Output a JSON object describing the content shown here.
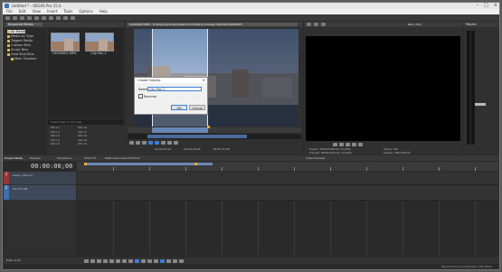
{
  "window": {
    "title": "Untitled * - VEGAS Pro 15.0"
  },
  "menu": [
    "File",
    "Edit",
    "View",
    "Insert",
    "Tools",
    "Options",
    "Help"
  ],
  "explorer": {
    "dropdown": "Imported Media",
    "tree": [
      {
        "label": "All Media",
        "selected": true
      },
      {
        "label": "Media by Type",
        "selected": false
      },
      {
        "label": "Tagged Media",
        "selected": false
      },
      {
        "label": "Custom Bins",
        "selected": false
      },
      {
        "label": "Smart Bins",
        "selected": false
      },
      {
        "label": "Hold Shot Bins",
        "selected": false
      },
      {
        "label": "Main Timeline",
        "selected": false
      }
    ],
    "media": [
      {
        "label": "C0000001.MP4"
      },
      {
        "label": "City Pan 1"
      }
    ],
    "tag_placeholder": "Select tags or add tags",
    "shortcuts": [
      {
        "key": "Ctrl+1",
        "value": "Ctrl+6"
      },
      {
        "key": "Ctrl+2",
        "value": "Ctrl+7"
      },
      {
        "key": "Ctrl+3",
        "value": "Ctrl+8"
      },
      {
        "key": "Ctrl+4",
        "value": "Ctrl+9"
      },
      {
        "key": "Ctrl+5",
        "value": "Ctrl+0"
      }
    ]
  },
  "trimmer": {
    "tab": "C0000001.MP4 - D:\\Ongoing Projects\\Random Building Footage 1\\DCIM\\100MSDCF\\",
    "status": [
      "00:00:04.24",
      "00:00:09.08",
      "00:00:05.08"
    ]
  },
  "dialog": {
    "title": "Create Subclip",
    "name_label": "Name:",
    "name_value": "City Pan 2",
    "reverse_label": "Reverse",
    "ok": "OK",
    "cancel": "Cancel"
  },
  "preview": {
    "quality": "Best (Full)",
    "info": {
      "project": "Project:  3840x2160x32, 23.976p",
      "preview": "Preview:  3840x2160x32, 23.976p",
      "frame": "Frame:   140",
      "display": "Display:  285x160x32"
    }
  },
  "master": {
    "label": "Master"
  },
  "tabs": [
    "Project Media",
    "Explorer",
    "Transitions",
    "Video FX",
    "Media Generators",
    "Trimmer",
    "Video Preview"
  ],
  "timeline": {
    "time": "00:00:00;00",
    "tracks": [
      {
        "num": "1",
        "type": "video",
        "level": "Level: 100.0 %"
      },
      {
        "num": "2",
        "type": "audio",
        "level": "Vol: 0.0 dB"
      }
    ],
    "rate": "Rate: 0.00",
    "record_time": "Record Time (2 channels): 145:36:02"
  },
  "colors": {
    "accent": "#3c7fd6",
    "video_track": "#9a3434",
    "audio_track": "#3c6fb0",
    "loop_region": "#6b87b5",
    "marker": "#e0b030"
  }
}
